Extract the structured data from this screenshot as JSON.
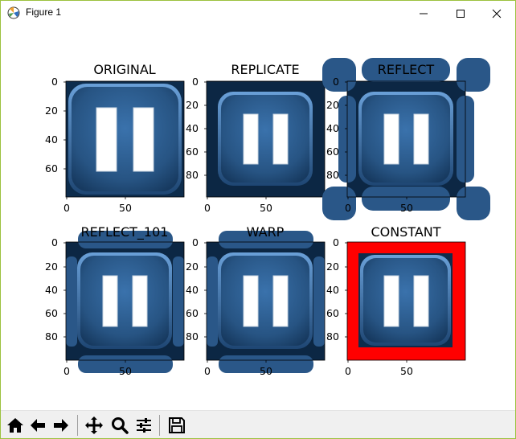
{
  "window": {
    "title": "Figure 1"
  },
  "subplots": [
    {
      "title": "ORIGINAL",
      "yticks": [
        "0",
        "20",
        "40",
        "60"
      ],
      "xticks": [
        "0",
        "50"
      ]
    },
    {
      "title": "REPLICATE",
      "yticks": [
        "0",
        "20",
        "40",
        "60",
        "80"
      ],
      "xticks": [
        "0",
        "50"
      ]
    },
    {
      "title": "REFLECT",
      "yticks": [
        "0",
        "20",
        "40",
        "60",
        "80"
      ],
      "xticks": [
        "0",
        "50"
      ]
    },
    {
      "title": "REFLECT_101",
      "yticks": [
        "0",
        "20",
        "40",
        "60",
        "80"
      ],
      "xticks": [
        "0",
        "50"
      ]
    },
    {
      "title": "WARP",
      "yticks": [
        "0",
        "20",
        "40",
        "60",
        "80"
      ],
      "xticks": [
        "0",
        "50"
      ]
    },
    {
      "title": "CONSTANT",
      "yticks": [
        "0",
        "20",
        "40",
        "60",
        "80"
      ],
      "xticks": [
        "0",
        "50"
      ]
    }
  ],
  "colors": {
    "border_constant": "#ff0000",
    "tile_dark": "#0c2a4a",
    "tile_mid": "#2c5b8e",
    "tile_light": "#4a82bf",
    "bar": "#ffffff",
    "window_border": "#9cc23f"
  },
  "toolbar": {
    "icons": [
      "home-icon",
      "back-arrow-icon",
      "forward-arrow-icon",
      "pan-move-icon",
      "zoom-magnifier-icon",
      "subplots-config-icon",
      "save-floppy-icon"
    ]
  }
}
